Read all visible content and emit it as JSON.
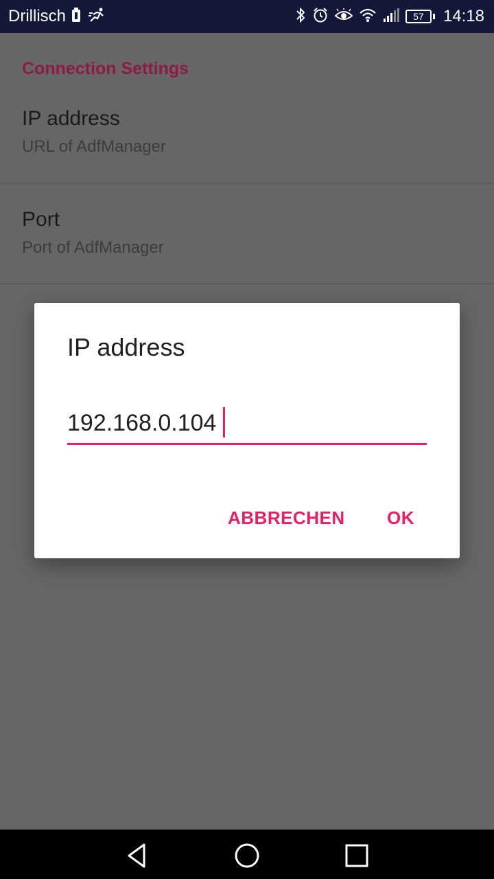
{
  "status_bar": {
    "carrier": "Drillisch",
    "battery_level": "57",
    "time": "14:18",
    "icons": [
      "sim-icon",
      "activity-icon",
      "bluetooth-icon",
      "alarm-icon",
      "eye-icon",
      "wifi-icon",
      "signal-icon",
      "battery-icon"
    ]
  },
  "settings": {
    "section_title": "Connection Settings",
    "items": [
      {
        "title": "IP address",
        "summary": "URL of AdfManager"
      },
      {
        "title": "Port",
        "summary": "Port of AdfManager"
      }
    ]
  },
  "dialog": {
    "title": "IP address",
    "input_value": "192.168.0.104",
    "cancel_label": "ABBRECHEN",
    "ok_label": "OK"
  },
  "nav_bar": {
    "buttons": [
      "back-icon",
      "home-icon",
      "recents-icon"
    ]
  },
  "colors": {
    "accent": "#e91e63",
    "section_title": "#8e1a48",
    "status_bar": "#13183a",
    "scrim_background": "#666666"
  }
}
